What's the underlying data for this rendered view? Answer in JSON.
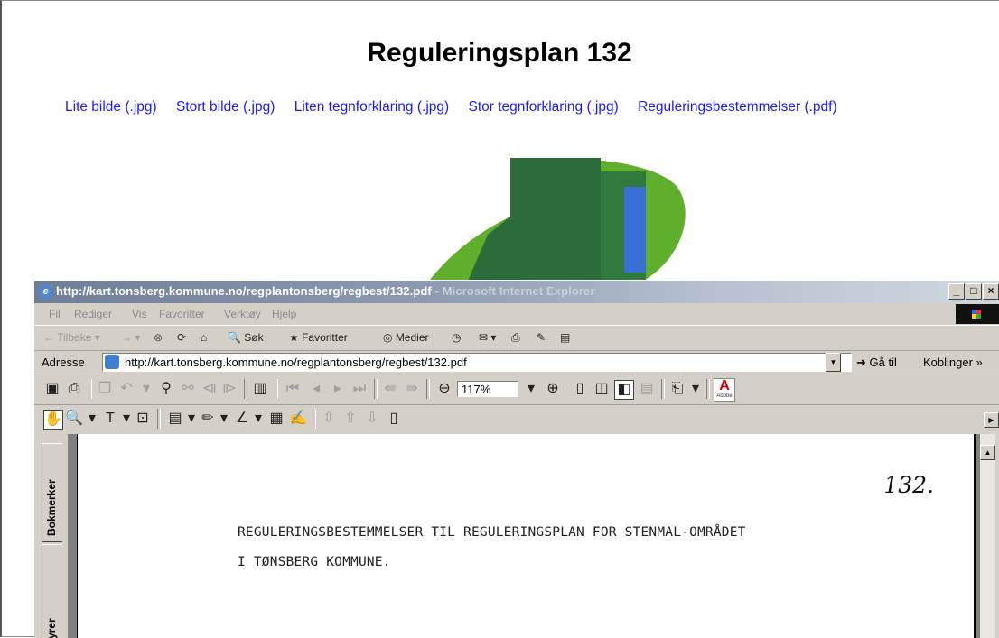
{
  "page": {
    "title": "Reguleringsplan 132",
    "links": [
      "Lite bilde (.jpg)",
      "Stort bilde (.jpg)",
      "Liten tegnforklaring (.jpg)",
      "Stor tegnforklaring (.jpg)",
      "Reguleringsbestemmelser (.pdf)"
    ]
  },
  "window": {
    "title_url": "http://kart.tonsberg.kommune.no/regplantonsberg/regbest/132.pdf",
    "title_suffix": " - Microsoft Internet Explorer",
    "controls": [
      "_",
      "□",
      "×"
    ]
  },
  "menubar": [
    "Fil",
    "Rediger",
    "Vis",
    "Favoritter",
    "Verktøy",
    "Hjelp"
  ],
  "toolbar": {
    "back": "Tilbake",
    "search": "Søk",
    "favorites": "Favoritter",
    "media": "Medier"
  },
  "address": {
    "label": "Adresse",
    "value": "http://kart.tonsberg.kommune.no/regplantonsberg/regbest/132.pdf",
    "go": "Gå til",
    "links": "Koblinger"
  },
  "acrobat": {
    "zoom": "117%"
  },
  "sidetabs": [
    "Bokmerker",
    "yrer"
  ],
  "document": {
    "number": "132.",
    "line1": "REGULERINGSBESTEMMELSER TIL REGULERINGSPLAN FOR STENMAL-OMRÅDET",
    "line2": "I TØNSBERG KOMMUNE."
  },
  "colors": {
    "link": "#1a1aff",
    "map_dark_green": "#2c6b3a",
    "map_light_green": "#5fae2c",
    "map_blue": "#3a6fd6"
  }
}
